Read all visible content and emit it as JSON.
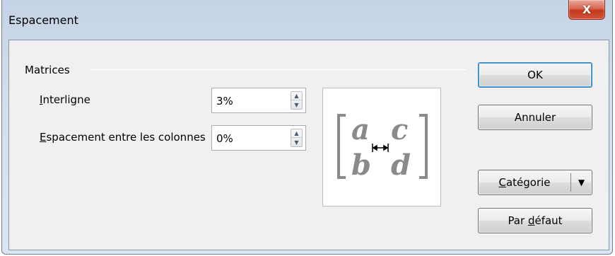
{
  "window": {
    "title": "Espacement",
    "close_glyph": "X"
  },
  "group": {
    "label": "Matrices"
  },
  "fields": {
    "interligne": {
      "label_mnemonic": "I",
      "label_rest": "nterligne",
      "value": "3%"
    },
    "espacement_colonnes": {
      "label_mnemonic": "E",
      "label_rest": "spacement entre les colonnes",
      "value": "0%"
    }
  },
  "preview": {
    "symbols": [
      "a",
      "c",
      "b",
      "d"
    ],
    "icon": "matrix-spacing-preview"
  },
  "buttons": {
    "ok": "OK",
    "annuler": "Annuler",
    "categorie_mnemonic": "C",
    "categorie_rest": "atégorie",
    "par_defaut_prefix": "Par ",
    "par_defaut_mnemonic": "d",
    "par_defaut_rest": "éfaut"
  },
  "colors": {
    "close_button": "#c4371b",
    "default_button_border": "#3c7fb1",
    "preview_glyph": "#8a8a8a"
  }
}
